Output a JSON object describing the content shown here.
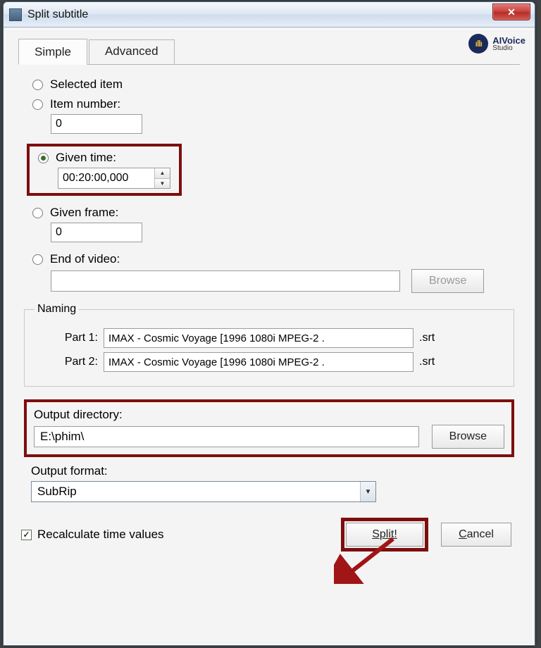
{
  "window": {
    "title": "Split subtitle"
  },
  "logo": {
    "name": "AIVoice",
    "sub": "Studio"
  },
  "tabs": {
    "simple": "Simple",
    "advanced": "Advanced"
  },
  "options": {
    "selected_item": "Selected item",
    "item_number_label": "Item number:",
    "item_number_value": "0",
    "given_time_label": "Given time:",
    "given_time_value": "00:20:00,000",
    "given_frame_label": "Given frame:",
    "given_frame_value": "0",
    "end_of_video_label": "End of video:",
    "end_of_video_path": "",
    "browse": "Browse"
  },
  "naming": {
    "legend": "Naming",
    "part1_label": "Part 1:",
    "part1_value": "IMAX - Cosmic Voyage [1996 1080i MPEG-2 .",
    "part2_label": "Part 2:",
    "part2_value": "IMAX - Cosmic Voyage [1996 1080i MPEG-2 .",
    "ext": ".srt"
  },
  "output": {
    "dir_label": "Output directory:",
    "dir_value": "E:\\phim\\",
    "browse": "Browse",
    "fmt_label": "Output format:",
    "fmt_value": "SubRip"
  },
  "footer": {
    "recalc": "Recalculate time values",
    "split": "Split!",
    "cancel": "Cancel"
  }
}
